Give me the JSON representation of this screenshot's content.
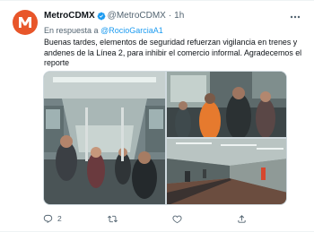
{
  "tweet": {
    "display_name": "MetroCDMX",
    "handle": "@MetroCDMX",
    "separator": "·",
    "time": "1h",
    "reply_prefix": "En respuesta a",
    "reply_to": "@RocioGarciaA1",
    "text": "Buenas tardes, elementos de seguridad refuerzan vigilancia en trenes y andenes de la Línea 2, para inhibir el comercio informal. Agradecemos el reporte",
    "verified": true
  },
  "media": {
    "photos": [
      {
        "name": "photo-train-interior"
      },
      {
        "name": "photo-security-staff"
      },
      {
        "name": "photo-station-platform"
      }
    ]
  },
  "actions": {
    "reply_count": "2",
    "retweet_count": "",
    "like_count": "",
    "share_count": ""
  },
  "icons": {
    "verified": "verified-badge-icon",
    "more": "more-options-icon",
    "reply": "reply-icon",
    "retweet": "retweet-icon",
    "like": "like-icon",
    "share": "share-icon"
  },
  "colors": {
    "accent": "#1d9bf0",
    "text": "#0f1419",
    "muted": "#536471",
    "avatar_bg": "#e8562a"
  }
}
